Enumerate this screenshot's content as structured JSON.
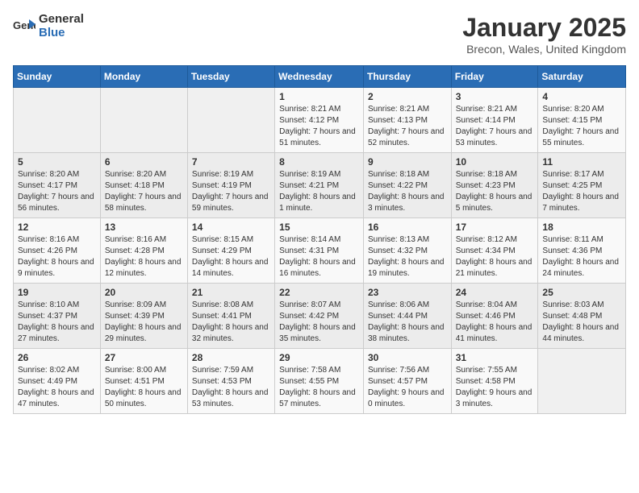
{
  "header": {
    "logo_general": "General",
    "logo_blue": "Blue",
    "month": "January 2025",
    "location": "Brecon, Wales, United Kingdom"
  },
  "weekdays": [
    "Sunday",
    "Monday",
    "Tuesday",
    "Wednesday",
    "Thursday",
    "Friday",
    "Saturday"
  ],
  "weeks": [
    [
      {
        "day": "",
        "sunrise": "",
        "sunset": "",
        "daylight": ""
      },
      {
        "day": "",
        "sunrise": "",
        "sunset": "",
        "daylight": ""
      },
      {
        "day": "",
        "sunrise": "",
        "sunset": "",
        "daylight": ""
      },
      {
        "day": "1",
        "sunrise": "Sunrise: 8:21 AM",
        "sunset": "Sunset: 4:12 PM",
        "daylight": "Daylight: 7 hours and 51 minutes."
      },
      {
        "day": "2",
        "sunrise": "Sunrise: 8:21 AM",
        "sunset": "Sunset: 4:13 PM",
        "daylight": "Daylight: 7 hours and 52 minutes."
      },
      {
        "day": "3",
        "sunrise": "Sunrise: 8:21 AM",
        "sunset": "Sunset: 4:14 PM",
        "daylight": "Daylight: 7 hours and 53 minutes."
      },
      {
        "day": "4",
        "sunrise": "Sunrise: 8:20 AM",
        "sunset": "Sunset: 4:15 PM",
        "daylight": "Daylight: 7 hours and 55 minutes."
      }
    ],
    [
      {
        "day": "5",
        "sunrise": "Sunrise: 8:20 AM",
        "sunset": "Sunset: 4:17 PM",
        "daylight": "Daylight: 7 hours and 56 minutes."
      },
      {
        "day": "6",
        "sunrise": "Sunrise: 8:20 AM",
        "sunset": "Sunset: 4:18 PM",
        "daylight": "Daylight: 7 hours and 58 minutes."
      },
      {
        "day": "7",
        "sunrise": "Sunrise: 8:19 AM",
        "sunset": "Sunset: 4:19 PM",
        "daylight": "Daylight: 7 hours and 59 minutes."
      },
      {
        "day": "8",
        "sunrise": "Sunrise: 8:19 AM",
        "sunset": "Sunset: 4:21 PM",
        "daylight": "Daylight: 8 hours and 1 minute."
      },
      {
        "day": "9",
        "sunrise": "Sunrise: 8:18 AM",
        "sunset": "Sunset: 4:22 PM",
        "daylight": "Daylight: 8 hours and 3 minutes."
      },
      {
        "day": "10",
        "sunrise": "Sunrise: 8:18 AM",
        "sunset": "Sunset: 4:23 PM",
        "daylight": "Daylight: 8 hours and 5 minutes."
      },
      {
        "day": "11",
        "sunrise": "Sunrise: 8:17 AM",
        "sunset": "Sunset: 4:25 PM",
        "daylight": "Daylight: 8 hours and 7 minutes."
      }
    ],
    [
      {
        "day": "12",
        "sunrise": "Sunrise: 8:16 AM",
        "sunset": "Sunset: 4:26 PM",
        "daylight": "Daylight: 8 hours and 9 minutes."
      },
      {
        "day": "13",
        "sunrise": "Sunrise: 8:16 AM",
        "sunset": "Sunset: 4:28 PM",
        "daylight": "Daylight: 8 hours and 12 minutes."
      },
      {
        "day": "14",
        "sunrise": "Sunrise: 8:15 AM",
        "sunset": "Sunset: 4:29 PM",
        "daylight": "Daylight: 8 hours and 14 minutes."
      },
      {
        "day": "15",
        "sunrise": "Sunrise: 8:14 AM",
        "sunset": "Sunset: 4:31 PM",
        "daylight": "Daylight: 8 hours and 16 minutes."
      },
      {
        "day": "16",
        "sunrise": "Sunrise: 8:13 AM",
        "sunset": "Sunset: 4:32 PM",
        "daylight": "Daylight: 8 hours and 19 minutes."
      },
      {
        "day": "17",
        "sunrise": "Sunrise: 8:12 AM",
        "sunset": "Sunset: 4:34 PM",
        "daylight": "Daylight: 8 hours and 21 minutes."
      },
      {
        "day": "18",
        "sunrise": "Sunrise: 8:11 AM",
        "sunset": "Sunset: 4:36 PM",
        "daylight": "Daylight: 8 hours and 24 minutes."
      }
    ],
    [
      {
        "day": "19",
        "sunrise": "Sunrise: 8:10 AM",
        "sunset": "Sunset: 4:37 PM",
        "daylight": "Daylight: 8 hours and 27 minutes."
      },
      {
        "day": "20",
        "sunrise": "Sunrise: 8:09 AM",
        "sunset": "Sunset: 4:39 PM",
        "daylight": "Daylight: 8 hours and 29 minutes."
      },
      {
        "day": "21",
        "sunrise": "Sunrise: 8:08 AM",
        "sunset": "Sunset: 4:41 PM",
        "daylight": "Daylight: 8 hours and 32 minutes."
      },
      {
        "day": "22",
        "sunrise": "Sunrise: 8:07 AM",
        "sunset": "Sunset: 4:42 PM",
        "daylight": "Daylight: 8 hours and 35 minutes."
      },
      {
        "day": "23",
        "sunrise": "Sunrise: 8:06 AM",
        "sunset": "Sunset: 4:44 PM",
        "daylight": "Daylight: 8 hours and 38 minutes."
      },
      {
        "day": "24",
        "sunrise": "Sunrise: 8:04 AM",
        "sunset": "Sunset: 4:46 PM",
        "daylight": "Daylight: 8 hours and 41 minutes."
      },
      {
        "day": "25",
        "sunrise": "Sunrise: 8:03 AM",
        "sunset": "Sunset: 4:48 PM",
        "daylight": "Daylight: 8 hours and 44 minutes."
      }
    ],
    [
      {
        "day": "26",
        "sunrise": "Sunrise: 8:02 AM",
        "sunset": "Sunset: 4:49 PM",
        "daylight": "Daylight: 8 hours and 47 minutes."
      },
      {
        "day": "27",
        "sunrise": "Sunrise: 8:00 AM",
        "sunset": "Sunset: 4:51 PM",
        "daylight": "Daylight: 8 hours and 50 minutes."
      },
      {
        "day": "28",
        "sunrise": "Sunrise: 7:59 AM",
        "sunset": "Sunset: 4:53 PM",
        "daylight": "Daylight: 8 hours and 53 minutes."
      },
      {
        "day": "29",
        "sunrise": "Sunrise: 7:58 AM",
        "sunset": "Sunset: 4:55 PM",
        "daylight": "Daylight: 8 hours and 57 minutes."
      },
      {
        "day": "30",
        "sunrise": "Sunrise: 7:56 AM",
        "sunset": "Sunset: 4:57 PM",
        "daylight": "Daylight: 9 hours and 0 minutes."
      },
      {
        "day": "31",
        "sunrise": "Sunrise: 7:55 AM",
        "sunset": "Sunset: 4:58 PM",
        "daylight": "Daylight: 9 hours and 3 minutes."
      },
      {
        "day": "",
        "sunrise": "",
        "sunset": "",
        "daylight": ""
      }
    ]
  ]
}
